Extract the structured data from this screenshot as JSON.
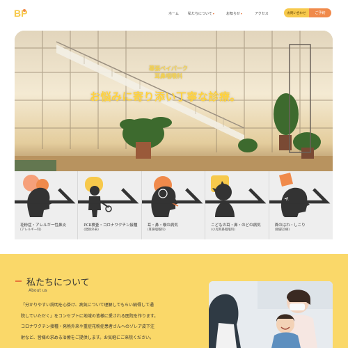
{
  "header": {
    "logo_text": "BP",
    "nav": [
      {
        "label": "ホーム",
        "has_caret": false
      },
      {
        "label": "私たちについて",
        "has_caret": true
      },
      {
        "label": "お知らせ",
        "has_caret": true
      },
      {
        "label": "アクセス",
        "has_caret": false
      }
    ],
    "contact_label": "お問い合わせ",
    "reserve_label": "ご予約"
  },
  "hero": {
    "title_line1": "幕張ベイパーク",
    "title_line2": "耳鼻咽喉科",
    "tagline": "お悩みに寄り添い丁寧な診療。"
  },
  "services": [
    {
      "title": "花粉症・アレルギー性鼻炎",
      "sub": "(アレルギー科)",
      "icon": "face-allergy-icon"
    },
    {
      "title": "PCR検査・コロナワクチン接種",
      "sub": "(発熱外来)",
      "icon": "vaccine-person-icon"
    },
    {
      "title": "耳・鼻・喉の病気",
      "sub": "(耳鼻咽喉科)",
      "icon": "ear-nose-throat-icon"
    },
    {
      "title": "こどもの耳・鼻・のどの病気",
      "sub": "(小児耳鼻咽喉科)",
      "icon": "child-face-icon"
    },
    {
      "title": "首のはれ・しこり",
      "sub": "(頸部診療)",
      "icon": "neck-icon"
    }
  ],
  "about": {
    "title": "私たちについて",
    "subtitle": "About us",
    "lines": [
      "「分かりやすい説明を心掛け、病気について理解してもらい納得して通",
      "院していただく」をコンセプトに地域の皆様に愛される医院を作ります。",
      "コロナワクチン接種・発熱外来や重症花粉症患者さんへのゾレア皮下注",
      "射など、皆様の求める治療をご提供します。お気軽にご来院ください。"
    ]
  },
  "colors": {
    "accent_yellow": "#fad869",
    "accent_orange": "#f08a4b",
    "logo_yellow": "#f7c94b",
    "card_bg": "#eeeeee"
  }
}
